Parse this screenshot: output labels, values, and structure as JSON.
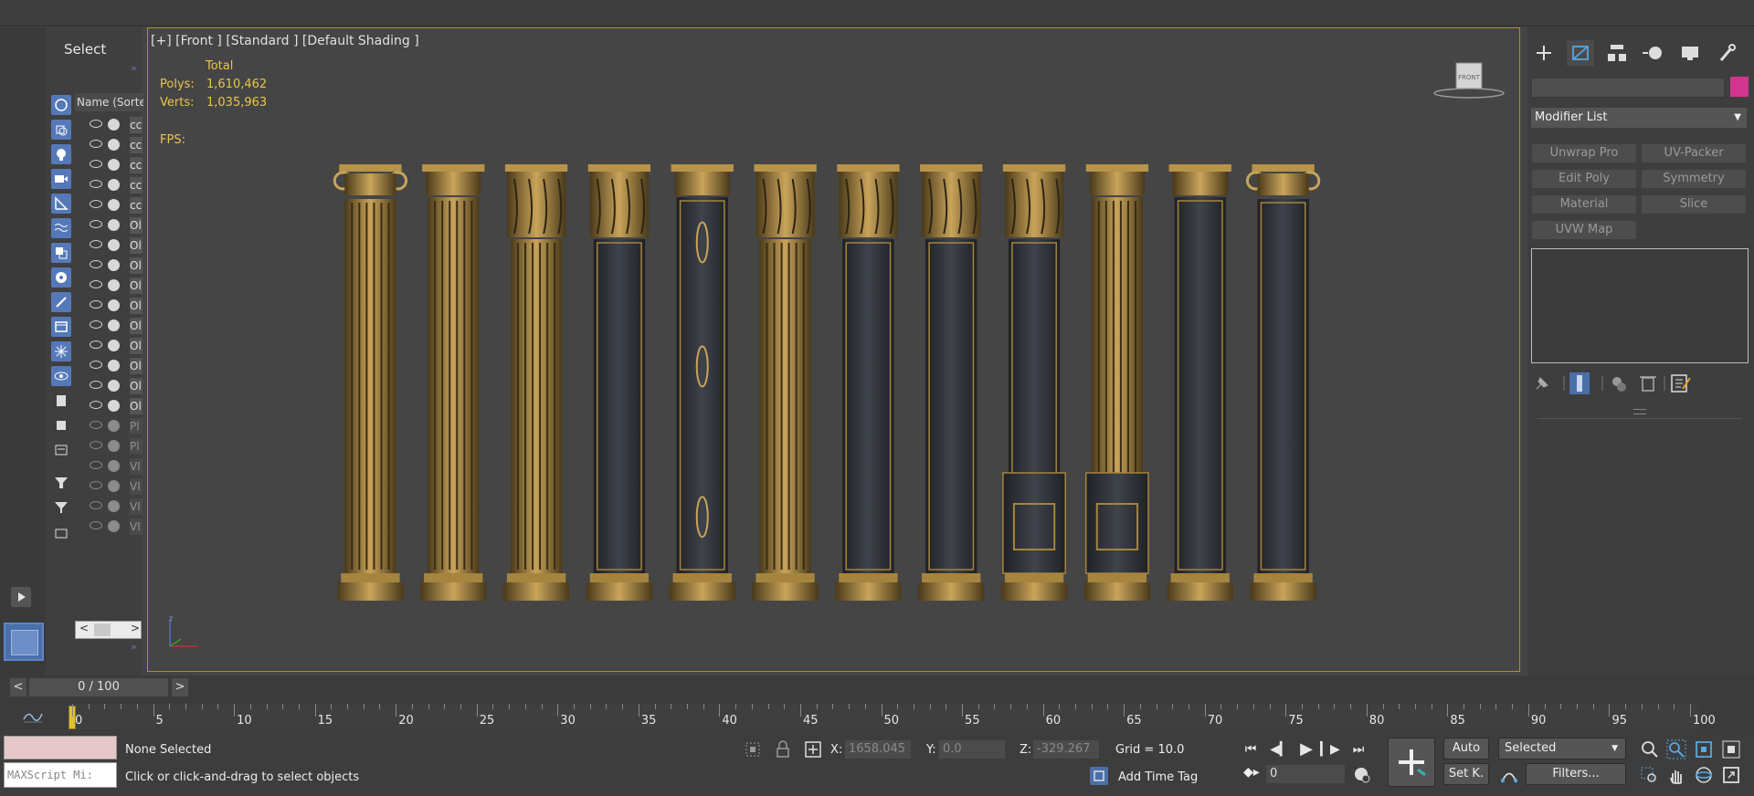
{
  "explorer": {
    "title": "Select",
    "column_header": "Name (Sorte",
    "rows": [
      {
        "label": "cc",
        "dim": false
      },
      {
        "label": "cc",
        "dim": false
      },
      {
        "label": "cc",
        "dim": false
      },
      {
        "label": "cc",
        "dim": false
      },
      {
        "label": "cc",
        "dim": false
      },
      {
        "label": "Ol",
        "dim": false
      },
      {
        "label": "Ol",
        "dim": false
      },
      {
        "label": "Ol",
        "dim": false
      },
      {
        "label": "Ol",
        "dim": false
      },
      {
        "label": "Ol",
        "dim": false
      },
      {
        "label": "Ol",
        "dim": false
      },
      {
        "label": "Ol",
        "dim": false
      },
      {
        "label": "Ol",
        "dim": false
      },
      {
        "label": "Ol",
        "dim": false
      },
      {
        "label": "Ol",
        "dim": false
      },
      {
        "label": "Pl",
        "dim": true
      },
      {
        "label": "Pl",
        "dim": true
      },
      {
        "label": "VI",
        "dim": true
      },
      {
        "label": "VI",
        "dim": true
      },
      {
        "label": "VI",
        "dim": true
      },
      {
        "label": "VI",
        "dim": true
      }
    ],
    "scroll_left": "<",
    "scroll_right": ">"
  },
  "viewport": {
    "label": "[+] [Front ] [Standard ] [Default Shading ]",
    "stats_header": "Total",
    "polys_label": "Polys:",
    "polys_value": "1,610,462",
    "verts_label": "Verts:",
    "verts_value": "1,035,963",
    "fps_label": "FPS:",
    "viewcube_label": "FRONT",
    "columns": [
      {
        "capital": "ionic",
        "shaft": "fluted"
      },
      {
        "capital": "plain",
        "shaft": "fluted"
      },
      {
        "capital": "corinthian",
        "shaft": "fluted"
      },
      {
        "capital": "corinthian",
        "shaft": "marble"
      },
      {
        "capital": "plain",
        "shaft": "ornament"
      },
      {
        "capital": "corinthian",
        "shaft": "fluted"
      },
      {
        "capital": "corinthian",
        "shaft": "marble"
      },
      {
        "capital": "corinthian",
        "shaft": "marble"
      },
      {
        "capital": "corinthian",
        "shaft": "pedestal"
      },
      {
        "capital": "plain",
        "shaft": "fluted-pedestal"
      },
      {
        "capital": "plain",
        "shaft": "marble"
      },
      {
        "capital": "ionic",
        "shaft": "marble"
      }
    ]
  },
  "command_panel": {
    "modifier_list_label": "Modifier List",
    "modifier_buttons": [
      "Unwrap Pro",
      "UV-Packer",
      "Edit Poly",
      "Symmetry",
      "Material",
      "Slice",
      "UVW Map"
    ],
    "swatch_color": "#d1358e"
  },
  "timeline": {
    "slider_label": "0 / 100",
    "prev": "<",
    "next": ">",
    "ticks": [
      "0",
      "5",
      "10",
      "15",
      "20",
      "25",
      "30",
      "35",
      "40",
      "45",
      "50",
      "55",
      "60",
      "65",
      "70",
      "75",
      "80",
      "85",
      "90",
      "95",
      "100"
    ]
  },
  "status": {
    "maxscript_label": "MAXScript Mi:",
    "selection": "None Selected",
    "prompt": "Click or click-and-drag to select objects",
    "x_label": "X:",
    "x_value": "1658.045",
    "y_label": "Y:",
    "y_value": "0.0",
    "z_label": "Z:",
    "z_value": "-329.267",
    "grid": "Grid = 10.0",
    "add_time_tag": "Add Time Tag",
    "auto_label": "Auto",
    "setkey_label": "Set K.",
    "selected_label": "Selected",
    "filters_label": "Filters...",
    "frame_value": "0"
  }
}
